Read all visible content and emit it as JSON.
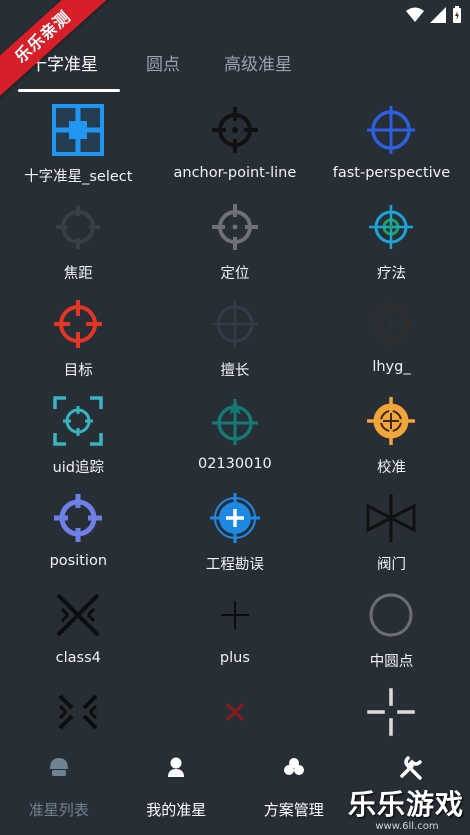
{
  "watermark": "乐乐亲测",
  "tabs": [
    {
      "label": "十字准星"
    },
    {
      "label": "圆点"
    },
    {
      "label": "高级准星"
    }
  ],
  "grid": [
    {
      "label": "十字准星_select",
      "icon": "blue-square-crosshair-icon",
      "color": "#2196f3"
    },
    {
      "label": "anchor-point-line",
      "icon": "black-circle-crosshair-icon",
      "color": "#111111"
    },
    {
      "label": "fast-perspective",
      "icon": "blue-circle-crosshair-icon",
      "color": "#2d5fe0"
    },
    {
      "label": "焦距",
      "icon": "dark-circle-crosshair-icon",
      "color": "#3a3f44"
    },
    {
      "label": "定位",
      "icon": "gray-circle-crosshair-icon",
      "color": "#6d7176"
    },
    {
      "label": "疗法",
      "icon": "cyan-green-crosshair-icon",
      "color": "#1ea3d6"
    },
    {
      "label": "目标",
      "icon": "red-circle-crosshair-icon",
      "color": "#e53524"
    },
    {
      "label": "擅长",
      "icon": "faint-circle-crosshair-icon",
      "color": "#353b45"
    },
    {
      "label": "lhyg_",
      "icon": "dark-plus-crosshair-icon",
      "color": "#2f2f2f"
    },
    {
      "label": "uid追踪",
      "icon": "teal-bracket-crosshair-icon",
      "color": "#3bb4c1"
    },
    {
      "label": "02130010",
      "icon": "teal-arrow-crosshair-icon",
      "color": "#167a74"
    },
    {
      "label": "校准",
      "icon": "orange-filled-crosshair-icon",
      "color": "#f2a53a"
    },
    {
      "label": "position",
      "icon": "purple-circle-crosshair-icon",
      "color": "#6f7fe8"
    },
    {
      "label": "工程勘误",
      "icon": "blue-plus-circle-icon",
      "color": "#1e88e5"
    },
    {
      "label": "阀门",
      "icon": "valve-icon",
      "color": "#111111"
    },
    {
      "label": "class4",
      "icon": "x-arrows-icon",
      "color": "#0d0d0d"
    },
    {
      "label": "plus",
      "icon": "thin-plus-icon",
      "color": "#0d0d0d"
    },
    {
      "label": "中圆点",
      "icon": "gray-ring-icon",
      "color": "#6b6f74"
    },
    {
      "label": "",
      "icon": "x-arrows-small-icon",
      "color": "#0d0d0d"
    },
    {
      "label": "",
      "icon": "red-x-icon",
      "color": "#8b1a1a"
    },
    {
      "label": "",
      "icon": "gap-cross-icon",
      "color": "#dddddd"
    }
  ],
  "nav": [
    {
      "label": "准星列表",
      "icon": "helmet-icon"
    },
    {
      "label": "我的准星",
      "icon": "person-icon"
    },
    {
      "label": "方案管理",
      "icon": "cloud-icon"
    },
    {
      "label": "",
      "icon": "tools-icon"
    }
  ],
  "brand": {
    "name": "乐乐游戏",
    "url": "www.6ll.com"
  }
}
